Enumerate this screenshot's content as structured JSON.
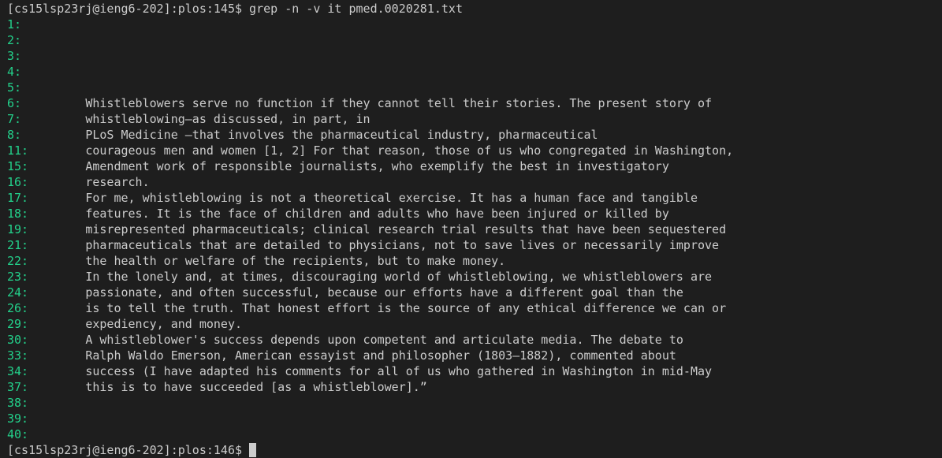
{
  "terminal": {
    "prompt1": "[cs15lsp23rj@ieng6-202]:plos:145$ ",
    "command": "grep -n -v it pmed.0020281.txt",
    "prompt2": "[cs15lsp23rj@ieng6-202]:plos:146$ ",
    "lines": [
      {
        "num": "1:",
        "text": ""
      },
      {
        "num": "2:",
        "text": ""
      },
      {
        "num": "3:",
        "text": ""
      },
      {
        "num": "4:",
        "text": ""
      },
      {
        "num": "5:",
        "text": ""
      },
      {
        "num": "6:",
        "text": "        Whistleblowers serve no function if they cannot tell their stories. The present story of"
      },
      {
        "num": "7:",
        "text": "        whistleblowing—as discussed, in part, in"
      },
      {
        "num": "8:",
        "text": "        PLoS Medicine —that involves the pharmaceutical industry, pharmaceutical"
      },
      {
        "num": "11:",
        "text": "        courageous men and women [1, 2] For that reason, those of us who congregated in Washington,"
      },
      {
        "num": "15:",
        "text": "        Amendment work of responsible journalists, who exemplify the best in investigatory"
      },
      {
        "num": "16:",
        "text": "        research."
      },
      {
        "num": "17:",
        "text": "        For me, whistleblowing is not a theoretical exercise. It has a human face and tangible"
      },
      {
        "num": "18:",
        "text": "        features. It is the face of children and adults who have been injured or killed by"
      },
      {
        "num": "19:",
        "text": "        misrepresented pharmaceuticals; clinical research trial results that have been sequestered"
      },
      {
        "num": "21:",
        "text": "        pharmaceuticals that are detailed to physicians, not to save lives or necessarily improve"
      },
      {
        "num": "22:",
        "text": "        the health or welfare of the recipients, but to make money."
      },
      {
        "num": "23:",
        "text": "        In the lonely and, at times, discouraging world of whistleblowing, we whistleblowers are"
      },
      {
        "num": "24:",
        "text": "        passionate, and often successful, because our efforts have a different goal than the"
      },
      {
        "num": "26:",
        "text": "        is to tell the truth. That honest effort is the source of any ethical difference we can or"
      },
      {
        "num": "29:",
        "text": "        expediency, and money."
      },
      {
        "num": "30:",
        "text": "        A whistleblower's success depends upon competent and articulate media. The debate to"
      },
      {
        "num": "33:",
        "text": "        Ralph Waldo Emerson, American essayist and philosopher (1803–1882), commented about"
      },
      {
        "num": "34:",
        "text": "        success (I have adapted his comments for all of us who gathered in Washington in mid-May"
      },
      {
        "num": "37:",
        "text": "        this is to have succeeded [as a whistleblower].”"
      },
      {
        "num": "38:",
        "text": ""
      },
      {
        "num": "39:",
        "text": ""
      },
      {
        "num": "40:",
        "text": ""
      }
    ]
  }
}
